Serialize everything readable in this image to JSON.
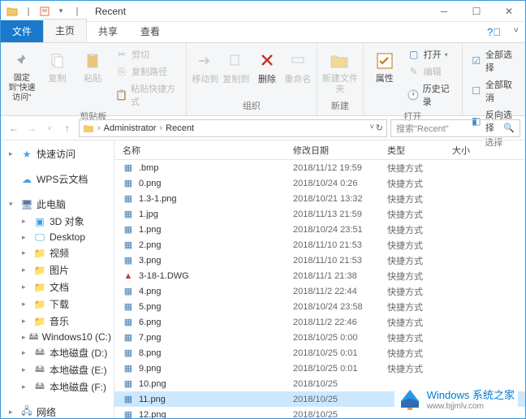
{
  "title": "Recent",
  "tabs": {
    "file": "文件",
    "home": "主页",
    "share": "共享",
    "view": "查看"
  },
  "ribbon": {
    "pin": "固定到\"快速访问\"",
    "copy": "复制",
    "paste": "粘贴",
    "cut": "剪切",
    "copy_path": "复制路径",
    "paste_shortcut": "粘贴快捷方式",
    "clipboard_group": "剪贴板",
    "move_to": "移动到",
    "copy_to": "复制到",
    "delete": "删除",
    "rename": "重命名",
    "organize_group": "组织",
    "new_folder": "新建文件夹",
    "new_group": "新建",
    "properties": "属性",
    "open": "打开",
    "edit": "编辑",
    "history": "历史记录",
    "open_group": "打开",
    "select_all": "全部选择",
    "select_none": "全部取消",
    "invert_selection": "反向选择",
    "select_group": "选择"
  },
  "breadcrumb": {
    "p1": "Administrator",
    "p2": "Recent"
  },
  "search_placeholder": "搜索\"Recent\"",
  "nav": {
    "quick_access": "快速访问",
    "wps": "WPS云文档",
    "this_pc": "此电脑",
    "objects3d": "3D 对象",
    "desktop": "Desktop",
    "videos": "视频",
    "pictures": "图片",
    "documents": "文档",
    "downloads": "下载",
    "music": "音乐",
    "win10c": "Windows10 (C:)",
    "local_d": "本地磁盘 (D:)",
    "local_e": "本地磁盘 (E:)",
    "local_f": "本地磁盘 (F:)",
    "network": "网络"
  },
  "columns": {
    "name": "名称",
    "date": "修改日期",
    "type": "类型",
    "size": "大小"
  },
  "type_label": "快捷方式",
  "files": [
    {
      "name": ".bmp",
      "date": "2018/11/12 19:59",
      "type": "快捷方式",
      "icon": "shortcut"
    },
    {
      "name": "0.png",
      "date": "2018/10/24 0:26",
      "type": "快捷方式",
      "icon": "shortcut"
    },
    {
      "name": "1.3-1.png",
      "date": "2018/10/21 13:32",
      "type": "快捷方式",
      "icon": "shortcut"
    },
    {
      "name": "1.jpg",
      "date": "2018/11/13 21:59",
      "type": "快捷方式",
      "icon": "shortcut"
    },
    {
      "name": "1.png",
      "date": "2018/10/24 23:51",
      "type": "快捷方式",
      "icon": "shortcut"
    },
    {
      "name": "2.png",
      "date": "2018/11/10 21:53",
      "type": "快捷方式",
      "icon": "shortcut"
    },
    {
      "name": "3.png",
      "date": "2018/11/10 21:53",
      "type": "快捷方式",
      "icon": "shortcut"
    },
    {
      "name": "3-18-1.DWG",
      "date": "2018/11/1 21:38",
      "type": "快捷方式",
      "icon": "dwg"
    },
    {
      "name": "4.png",
      "date": "2018/11/2 22:44",
      "type": "快捷方式",
      "icon": "shortcut"
    },
    {
      "name": "5.png",
      "date": "2018/10/24 23:58",
      "type": "快捷方式",
      "icon": "shortcut"
    },
    {
      "name": "6.png",
      "date": "2018/11/2 22:46",
      "type": "快捷方式",
      "icon": "shortcut"
    },
    {
      "name": "7.png",
      "date": "2018/10/25 0:00",
      "type": "快捷方式",
      "icon": "shortcut"
    },
    {
      "name": "8.png",
      "date": "2018/10/25 0:01",
      "type": "快捷方式",
      "icon": "shortcut"
    },
    {
      "name": "9.png",
      "date": "2018/10/25 0:01",
      "type": "快捷方式",
      "icon": "shortcut"
    },
    {
      "name": "10.png",
      "date": "2018/10/25",
      "type": "",
      "icon": "shortcut"
    },
    {
      "name": "11.png",
      "date": "2018/10/25",
      "type": "",
      "icon": "shortcut",
      "selected": true
    },
    {
      "name": "12.png",
      "date": "2018/10/25",
      "type": "",
      "icon": "shortcut"
    }
  ],
  "watermark": {
    "line1": "Windows 系统之家",
    "line2": "www.bjjmlv.com"
  }
}
